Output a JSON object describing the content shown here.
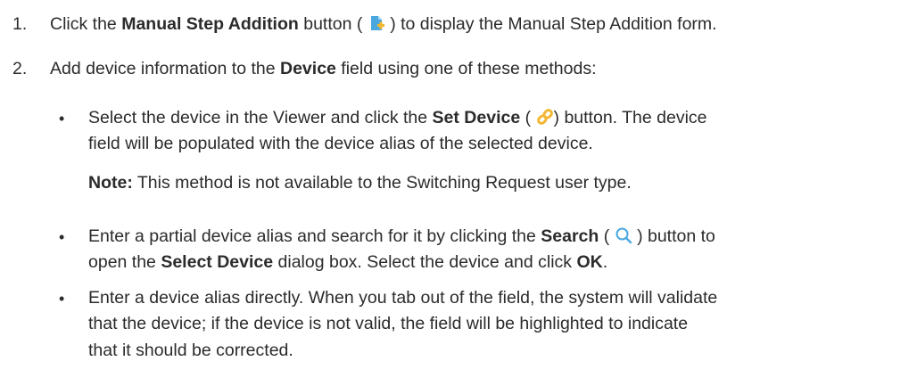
{
  "steps": [
    {
      "number": "1.",
      "pre": "Click the ",
      "bold": "Manual Step Addition",
      "mid": " button ( ",
      "post": " ) to display the Manual Step Addition form.",
      "icon": "add-document-icon"
    },
    {
      "number": "2.",
      "pre": "Add device information to the ",
      "bold": "Device",
      "post": " field using one of these methods:"
    }
  ],
  "methods": [
    {
      "bullet": "•",
      "pre": "Select the device in the Viewer and click the ",
      "bold": "Set Device",
      "mid": " ( ",
      "post1": ") button. The device",
      "line2": "field will be populated with the device alias of the selected device.",
      "icon": "link-icon"
    },
    {
      "bullet": "•",
      "pre": "Enter a partial device alias and search for it by clicking the ",
      "bold": "Search",
      "mid": " ( ",
      "post": " ) button to",
      "line2pre": "open the ",
      "line2bold": "Select Device",
      "line2mid": " dialog box. Select the device and click ",
      "line2bold2": "OK",
      "line2end": ".",
      "icon": "search-icon"
    },
    {
      "bullet": "•",
      "line1": "Enter a device alias directly. When you tab out of the field, the system will validate",
      "line2": "that the device; if the device is not valid, the field will be highlighted to indicate",
      "line3": "that it should be corrected."
    }
  ],
  "note": {
    "label": "Note:",
    "text": " This method is not available to the Switching Request user type."
  },
  "colors": {
    "text": "#2b2b2b",
    "icon_blue": "#4aa8e0",
    "icon_yellow": "#f2b632"
  }
}
